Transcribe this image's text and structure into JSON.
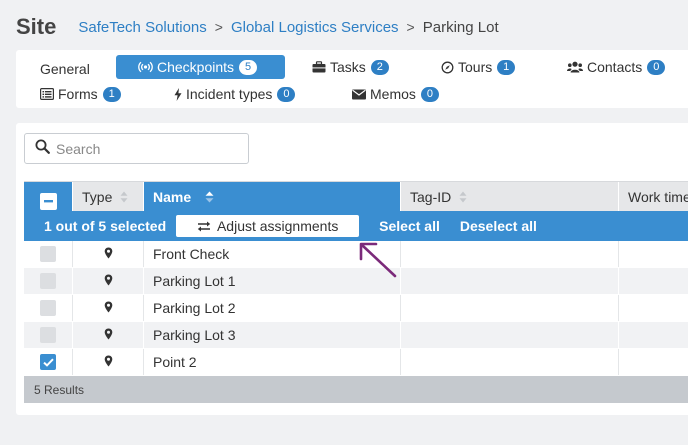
{
  "header": {
    "title": "Site",
    "breadcrumbs": [
      "SafeTech Solutions",
      "Global Logistics Services"
    ],
    "current": "Parking Lot",
    "separator": ">"
  },
  "tabs": [
    {
      "label": "General",
      "icon": "none",
      "badge": null,
      "active": false
    },
    {
      "label": "Checkpoints",
      "icon": "broadcast-icon",
      "badge": "5",
      "active": true
    },
    {
      "label": "Tasks",
      "icon": "briefcase-icon",
      "badge": "2",
      "active": false
    },
    {
      "label": "Tours",
      "icon": "compass-icon",
      "badge": "1",
      "active": false
    },
    {
      "label": "Contacts",
      "icon": "users-icon",
      "badge": "0",
      "active": false
    },
    {
      "label": "Forms",
      "icon": "list-icon",
      "badge": "1",
      "active": false
    },
    {
      "label": "Incident types",
      "icon": "bolt-icon",
      "badge": "0",
      "active": false
    },
    {
      "label": "Memos",
      "icon": "envelope-icon",
      "badge": "0",
      "active": false
    }
  ],
  "search": {
    "placeholder": "Search",
    "value": ""
  },
  "table": {
    "columns": [
      "Type",
      "Name",
      "Tag-ID",
      "Work time"
    ],
    "sorted_column": "Name",
    "selection": {
      "count_text": "1 out of 5 selected",
      "adjust_label": "Adjust assignments",
      "select_all": "Select all",
      "deselect_all": "Deselect all"
    },
    "rows": [
      {
        "name": "Front Check",
        "type_icon": "map-marker-icon",
        "checked": false
      },
      {
        "name": "Parking Lot 1",
        "type_icon": "map-marker-icon",
        "checked": false
      },
      {
        "name": "Parking Lot 2",
        "type_icon": "map-marker-icon",
        "checked": false
      },
      {
        "name": "Parking Lot 3",
        "type_icon": "map-marker-icon",
        "checked": false
      },
      {
        "name": "Point 2",
        "type_icon": "map-marker-icon",
        "checked": true
      }
    ],
    "footer": "5 Results"
  },
  "colors": {
    "accent": "#3a8ed1",
    "link": "#2e7fc4",
    "annotation_arrow": "#7b2a7a"
  }
}
